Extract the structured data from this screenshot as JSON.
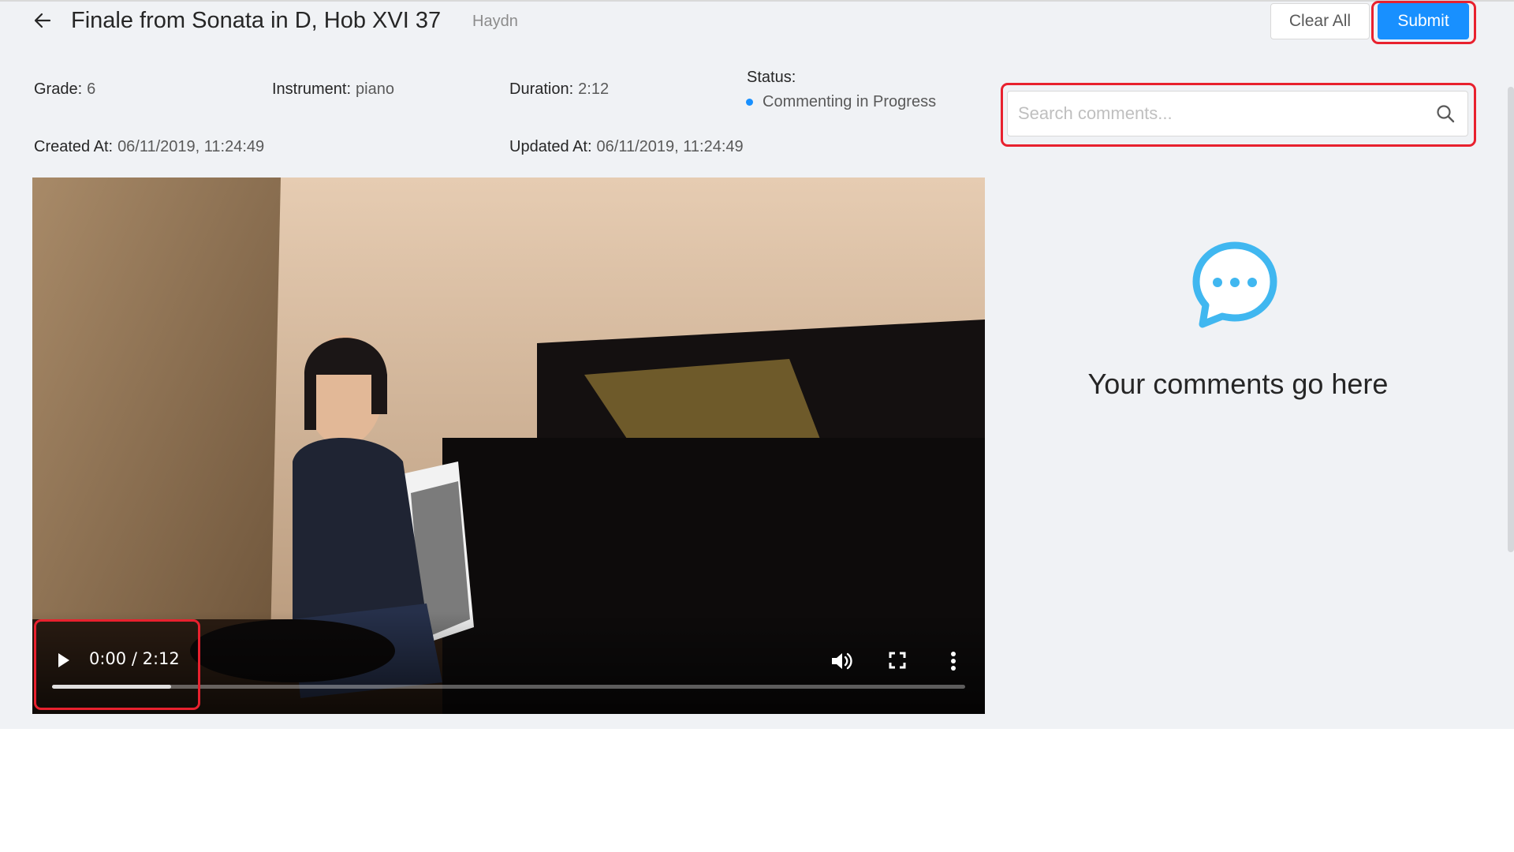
{
  "header": {
    "title": "Finale from Sonata in D, Hob XVI 37",
    "composer": "Haydn",
    "clear_label": "Clear All",
    "submit_label": "Submit"
  },
  "details": {
    "grade_label": "Grade:",
    "grade": "6",
    "instrument_label": "Instrument:",
    "instrument": "piano",
    "duration_label": "Duration:",
    "duration": "2:12",
    "status_label": "Status:",
    "status": "Commenting in Progress",
    "created_label": "Created At:",
    "created": "06/11/2019, 11:24:49",
    "updated_label": "Updated At:",
    "updated": "06/11/2019, 11:24:49"
  },
  "search": {
    "placeholder": "Search comments..."
  },
  "comments": {
    "empty_text": "Your comments go here"
  },
  "video": {
    "time": "0:00 / 2:12",
    "buffered_fraction": 0.13
  },
  "colors": {
    "accent": "#1890ff",
    "highlight": "#e8212e",
    "background": "#f0f2f5"
  },
  "icons": {
    "back": "arrow-left-icon",
    "search": "search-icon",
    "empty": "chat-bubble-icon",
    "play": "play-icon",
    "volume": "volume-icon",
    "fullscreen": "fullscreen-icon",
    "more": "more-vertical-icon"
  }
}
